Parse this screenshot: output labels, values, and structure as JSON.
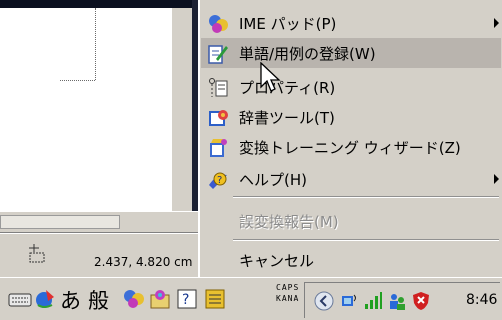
{
  "menu": {
    "items": [
      {
        "label": "IME パッド(P)",
        "icon": "ime-pad-icon",
        "submenu": true,
        "disabled": false,
        "highlighted": false
      },
      {
        "label": "単語/用例の登録(W)",
        "icon": "word-register-icon",
        "submenu": false,
        "disabled": false,
        "highlighted": true
      },
      {
        "label": "プロパティ(R)",
        "icon": "properties-icon",
        "submenu": false,
        "disabled": false,
        "highlighted": false
      },
      {
        "label": "辞書ツール(T)",
        "icon": "dictionary-tool-icon",
        "submenu": false,
        "disabled": false,
        "highlighted": false
      },
      {
        "label": "変換トレーニング ウィザード(Z)",
        "icon": "training-wizard-icon",
        "submenu": false,
        "disabled": false,
        "highlighted": false
      },
      {
        "label": "ヘルプ(H)",
        "icon": "help-icon",
        "submenu": true,
        "disabled": false,
        "highlighted": false
      },
      {
        "label": "誤変換報告(M)",
        "icon": "",
        "submenu": false,
        "disabled": true,
        "highlighted": false
      },
      {
        "label": "キャンセル",
        "icon": "",
        "submenu": false,
        "disabled": false,
        "highlighted": false
      }
    ]
  },
  "status_bar": {
    "coords": "2.437, 4.820 cm"
  },
  "taskbar": {
    "ime_mode": "あ",
    "ime_conversion": "般",
    "caps_top": "CAPS",
    "caps_bottom": "KANA",
    "clock": "8:46"
  },
  "colors": {
    "menu_bg": "#d4d0c8",
    "menu_highlight": "#b9b4ae",
    "disabled_text": "#8c8c8c"
  }
}
